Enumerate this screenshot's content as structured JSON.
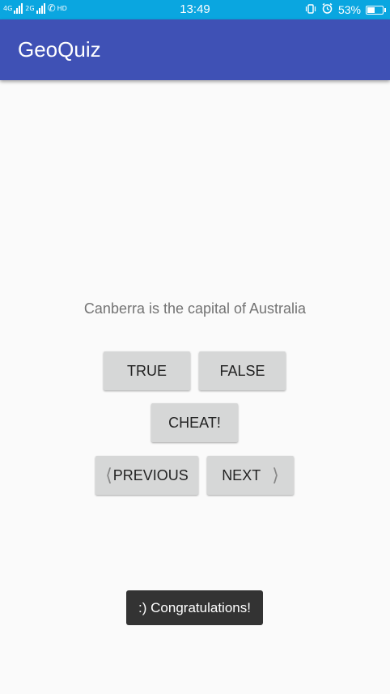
{
  "status_bar": {
    "network_4g": "4G",
    "network_2g": "2G",
    "hd_label": "HD",
    "time": "13:49",
    "battery_percent": "53%",
    "battery_level": 0.53,
    "icons": [
      "signal-icon",
      "phone-hd-icon",
      "vibrate-icon",
      "alarm-icon",
      "battery-icon"
    ]
  },
  "app_bar": {
    "title": "GeoQuiz",
    "color": "#3f51b5"
  },
  "question": {
    "text": "Canberra is the capital of Australia"
  },
  "buttons": {
    "true_label": "TRUE",
    "false_label": "FALSE",
    "cheat_label": "CHEAT!",
    "previous_label": "PREVIOUS",
    "next_label": "NEXT",
    "previous_icon": "chevron-left-icon",
    "next_icon": "chevron-right-icon"
  },
  "toast": {
    "text": ":) Congratulations!"
  },
  "colors": {
    "status_bar": "#0aa6e0",
    "background": "#fafafa",
    "button": "#d6d7d7",
    "toast": "#333333"
  }
}
